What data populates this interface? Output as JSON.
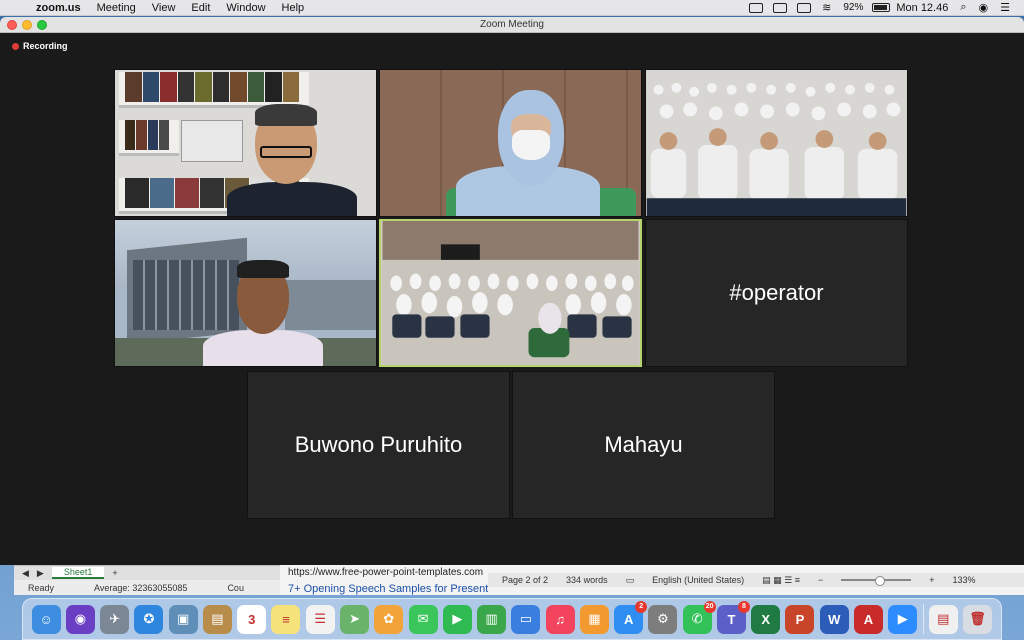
{
  "menubar": {
    "app_name": "zoom.us",
    "menus": [
      "Meeting",
      "View",
      "Edit",
      "Window",
      "Help"
    ],
    "battery": "92%",
    "clock": "Mon 12.46"
  },
  "window": {
    "title": "Zoom Meeting",
    "recording_label": "Recording"
  },
  "tiles": [
    {
      "type": "video",
      "participant": "video-1",
      "active": false
    },
    {
      "type": "video",
      "participant": "video-2",
      "active": false
    },
    {
      "type": "video",
      "participant": "video-3",
      "active": false
    },
    {
      "type": "video",
      "participant": "video-4",
      "active": false
    },
    {
      "type": "video",
      "participant": "video-5",
      "active": true
    },
    {
      "type": "name",
      "name": "#operator"
    },
    {
      "type": "name",
      "name": "Buwono Puruhito"
    },
    {
      "type": "name",
      "name": "Mahayu"
    }
  ],
  "excel": {
    "sheet_tab": "Sheet1",
    "add_sheet": "+",
    "status_ready": "Ready",
    "status_average": "Average: 32363055085",
    "status_count": "Cou"
  },
  "word": {
    "url": "https://www.free-power-point-templates.com",
    "link_text": "7+ Opening Speech Samples for Presentations & Quick Tips",
    "page": "Page 2 of 2",
    "words": "334 words",
    "language": "English (United States)",
    "zoom": "133%"
  },
  "dock": {
    "apps": [
      {
        "name": "finder-icon",
        "color": "#3d8ee0",
        "glyph": "☺"
      },
      {
        "name": "siri-icon",
        "color": "#6a3fc4",
        "glyph": "◉"
      },
      {
        "name": "launchpad-icon",
        "color": "#7c8796",
        "glyph": "✈"
      },
      {
        "name": "safari-icon",
        "color": "#2f86de",
        "glyph": "✪"
      },
      {
        "name": "preview-icon",
        "color": "#5f8fb8",
        "glyph": "▣"
      },
      {
        "name": "notes-brown-icon",
        "color": "#b88d4c",
        "glyph": "▤"
      },
      {
        "name": "calendar-icon",
        "color": "#ffffff",
        "glyph": "3"
      },
      {
        "name": "notes-icon",
        "color": "#f5e27a",
        "glyph": "≡"
      },
      {
        "name": "reminders-icon",
        "color": "#f2f2f2",
        "glyph": "☰"
      },
      {
        "name": "maps-icon",
        "color": "#6ab36b",
        "glyph": "➤"
      },
      {
        "name": "photos-icon",
        "color": "#f2a43a",
        "glyph": "✿"
      },
      {
        "name": "messages-icon",
        "color": "#3ac65a",
        "glyph": "✉"
      },
      {
        "name": "facetime-icon",
        "color": "#2fba52",
        "glyph": "▶"
      },
      {
        "name": "numbers-icon",
        "color": "#3aa84a",
        "glyph": "▥"
      },
      {
        "name": "keynote-icon",
        "color": "#3a7fe0",
        "glyph": "▭"
      },
      {
        "name": "music-icon",
        "color": "#f2445c",
        "glyph": "♫"
      },
      {
        "name": "books-icon",
        "color": "#f29a2f",
        "glyph": "▦"
      },
      {
        "name": "app-store-icon",
        "color": "#2f8ef2",
        "glyph": "A",
        "badge": "2"
      },
      {
        "name": "system-preferences-icon",
        "color": "#7d7d7d",
        "glyph": "⚙"
      },
      {
        "name": "whatsapp-icon",
        "color": "#33c25a",
        "glyph": "✆",
        "badge": "20"
      },
      {
        "name": "teams-icon",
        "color": "#5b5fc7",
        "glyph": "T",
        "badge": "8"
      },
      {
        "name": "excel-icon",
        "color": "#1f7a43",
        "glyph": "X"
      },
      {
        "name": "powerpoint-icon",
        "color": "#c8452a",
        "glyph": "P"
      },
      {
        "name": "word-icon",
        "color": "#2b5cb8",
        "glyph": "W"
      },
      {
        "name": "acrobat-icon",
        "color": "#c92a2a",
        "glyph": "A"
      },
      {
        "name": "zoom-icon",
        "color": "#2d8cff",
        "glyph": "▶"
      },
      {
        "name": "document-icon",
        "color": "#f0f0f0",
        "glyph": "▤"
      },
      {
        "name": "trash-icon",
        "color": "#d8dde3",
        "glyph": "🗑"
      }
    ]
  }
}
